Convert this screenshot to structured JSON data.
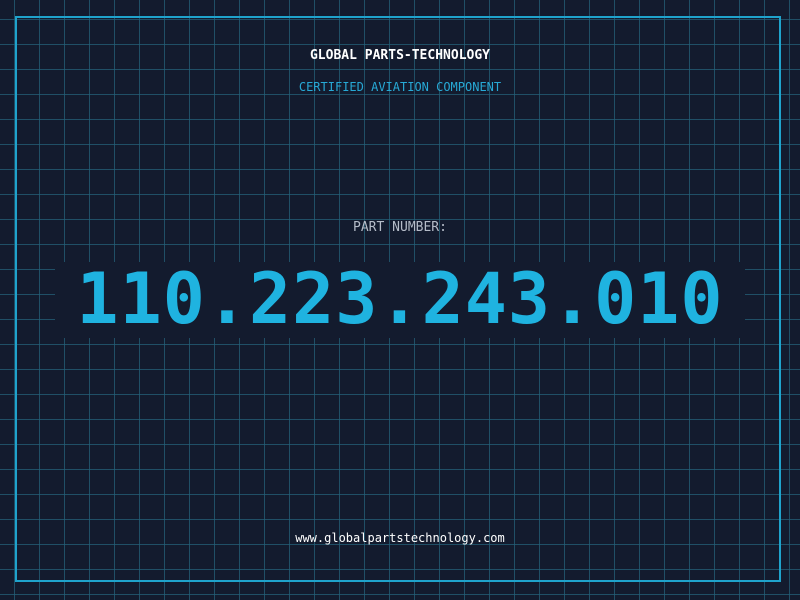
{
  "header": {
    "company_name": "GLOBAL PARTS-TECHNOLOGY",
    "tagline": "CERTIFIED AVIATION COMPONENT"
  },
  "part": {
    "label": "PART NUMBER:",
    "number": "110.223.243.010"
  },
  "footer": {
    "website": "www.globalpartstechnology.com"
  },
  "colors": {
    "background": "#131b2e",
    "grid": "#246078",
    "accent": "#1fb3e0",
    "frame": "#1fa3cc"
  }
}
